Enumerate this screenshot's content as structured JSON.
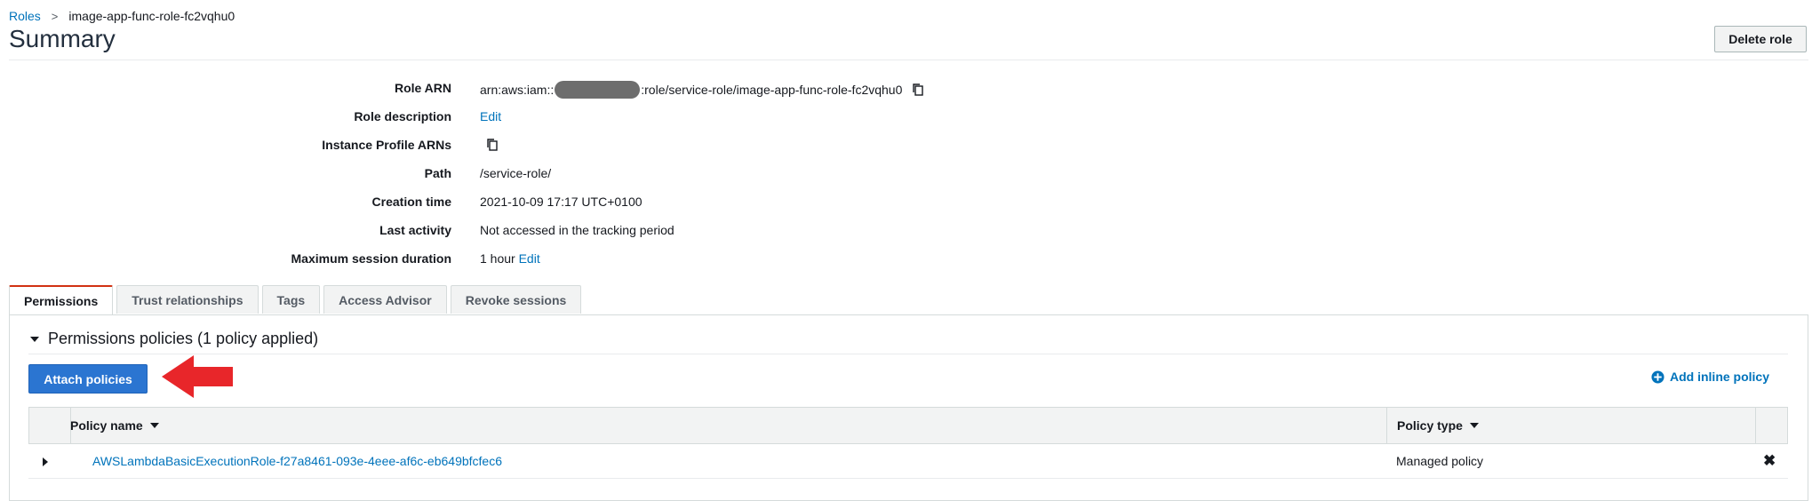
{
  "breadcrumb": {
    "parent": "Roles",
    "separator": ">",
    "current": "image-app-func-role-fc2vqhu0"
  },
  "page": {
    "title": "Summary",
    "delete_label": "Delete role"
  },
  "details": {
    "role_arn": {
      "label": "Role ARN",
      "prefix": "arn:aws:iam::",
      "suffix": ":role/service-role/image-app-func-role-fc2vqhu0"
    },
    "role_description": {
      "label": "Role description",
      "link": "Edit"
    },
    "instance_profile_arns": {
      "label": "Instance Profile ARNs"
    },
    "path": {
      "label": "Path",
      "value": "/service-role/"
    },
    "creation_time": {
      "label": "Creation time",
      "value": "2021-10-09 17:17 UTC+0100"
    },
    "last_activity": {
      "label": "Last activity",
      "value": "Not accessed in the tracking period"
    },
    "max_session": {
      "label": "Maximum session duration",
      "value": "1 hour",
      "link": "Edit"
    }
  },
  "tabs": [
    {
      "label": "Permissions",
      "active": true
    },
    {
      "label": "Trust relationships",
      "active": false
    },
    {
      "label": "Tags",
      "active": false
    },
    {
      "label": "Access Advisor",
      "active": false
    },
    {
      "label": "Revoke sessions",
      "active": false
    }
  ],
  "permissions": {
    "section_title": "Permissions policies (1 policy applied)",
    "attach_label": "Attach policies",
    "add_inline_label": "Add inline policy",
    "columns": {
      "policy_name": "Policy name",
      "policy_type": "Policy type"
    },
    "rows": [
      {
        "name": "AWSLambdaBasicExecutionRole-f27a8461-093e-4eee-af6c-eb649bfcfec6",
        "type": "Managed policy"
      }
    ]
  },
  "colors": {
    "link": "#0073bb",
    "primary_button": "#2b75d1",
    "active_tab_accent": "#d13212",
    "annotation_arrow": "#e8262a"
  },
  "icons": {
    "copy": "copy-icon",
    "plus": "plus-circle-icon",
    "remove": "close-icon",
    "arrow": "arrow-left-icon"
  }
}
